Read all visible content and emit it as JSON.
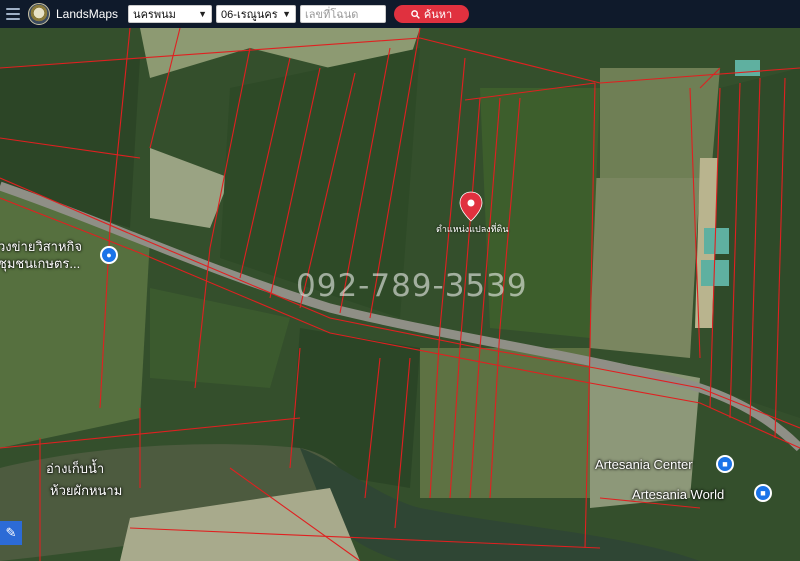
{
  "app": {
    "brand": "LandsMaps"
  },
  "filters": {
    "province": "นครพนม",
    "district": "06-เรณูนคร",
    "deed_placeholder": "เลขที่โฉนด",
    "search_label": "ค้นหา"
  },
  "map": {
    "watermark": "092-789-3539",
    "pin_label": "ตำแหน่งแปลงที่ดิน",
    "poi_left": "วงข่ายวิสาหกิจชุมชนเกษตร...",
    "lake_label_1": "อ่างเก็บน้ำ",
    "lake_label_2": "ห้วยผักหนาม",
    "poi_artesania_center": "Artesania Center",
    "poi_artesania_world": "Artesania World"
  },
  "colors": {
    "topbar": "#0f1a2b",
    "accent": "#e0313f",
    "parcel_lines": "#e02020",
    "poi_blue": "#1a73e8"
  },
  "icons": {
    "menu": "hamburger-icon",
    "search": "search-icon",
    "pin": "location-pin-icon",
    "tool": "measure-tool-icon"
  }
}
